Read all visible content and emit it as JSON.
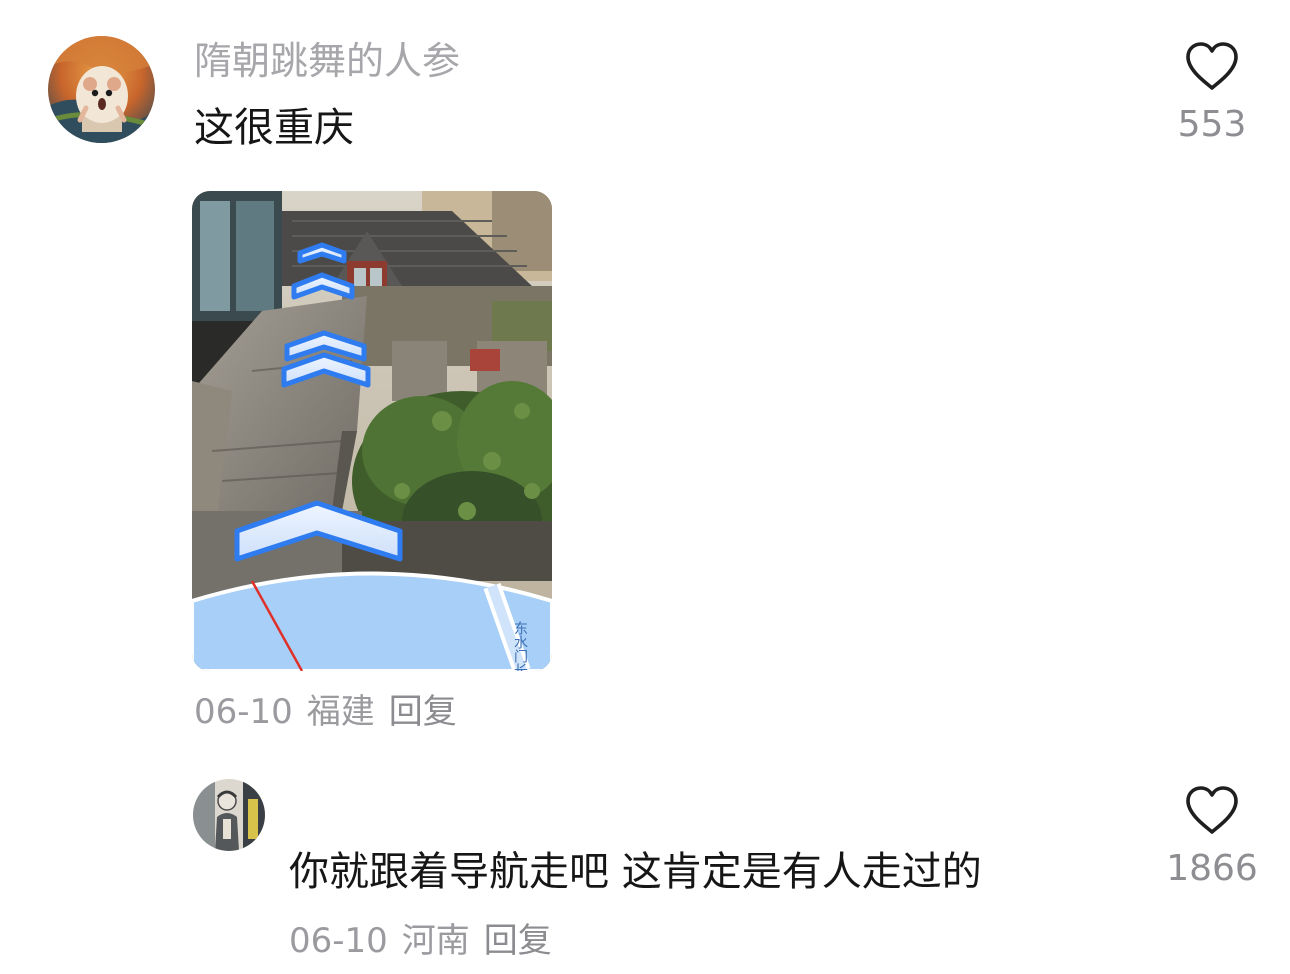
{
  "comments": [
    {
      "username": "隋朝跳舞的人参",
      "text": "这很重庆",
      "date": "06-10",
      "location": "福建",
      "reply_label": "回复",
      "likes": "553",
      "avatar_icon": "hamster-scream-avatar",
      "image": {
        "description_icon": "ar-navigation-photo",
        "map_street_label": "东水门长江"
      }
    },
    {
      "username": "",
      "text": "你就跟着导航走吧 这肯定是有人走过的",
      "date": "06-10",
      "location": "河南",
      "reply_label": "回复",
      "likes": "1866",
      "avatar_icon": "illustrated-person-avatar"
    }
  ],
  "colors": {
    "username": "#a7a7ab",
    "meta": "#9b9b9f",
    "text": "#161616",
    "like_icon": "#1f1f1f",
    "ar_arrow_blue": "#2f7cf0",
    "map_blue": "#a8cff8"
  }
}
